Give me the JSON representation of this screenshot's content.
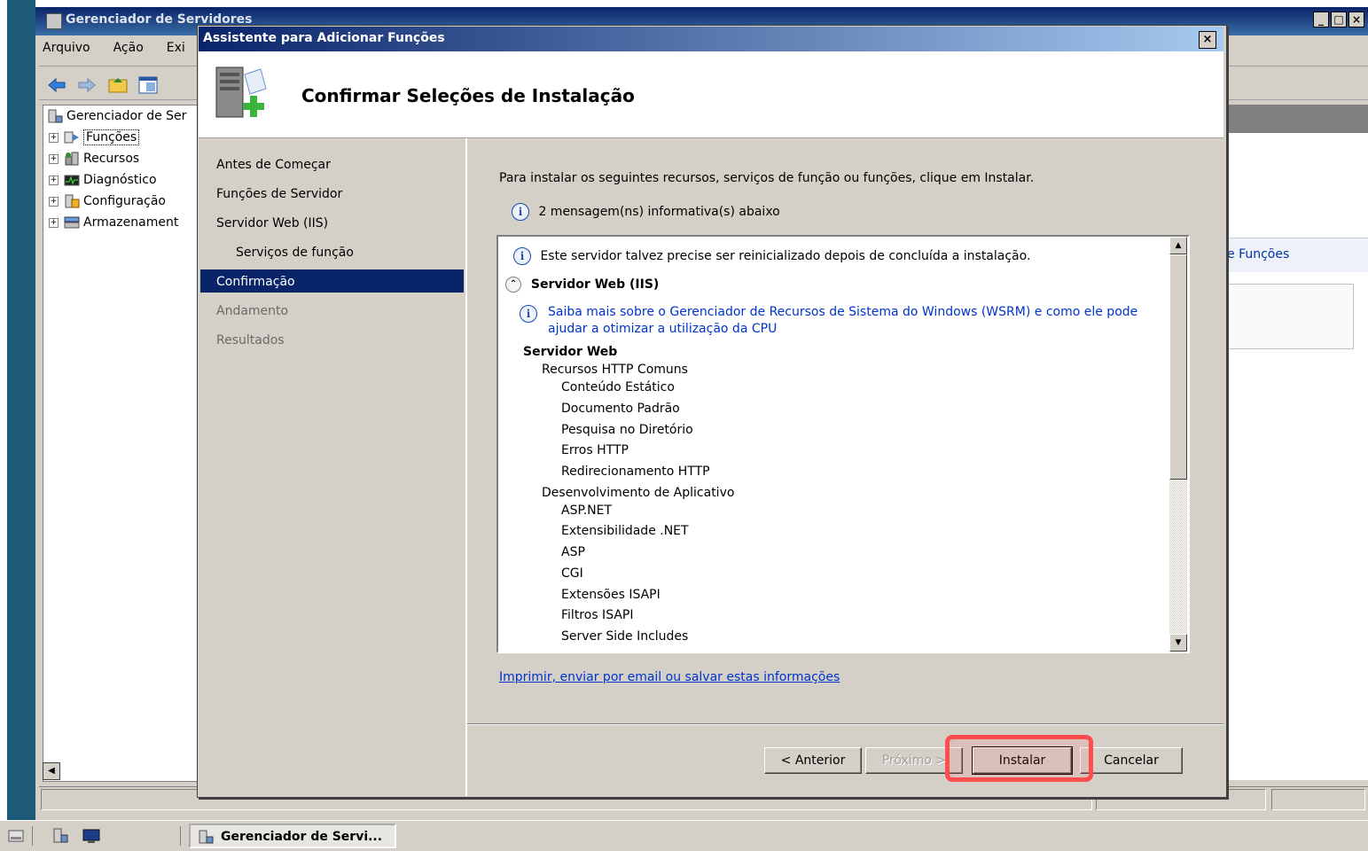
{
  "background_window": {
    "title": "Gerenciador de Servidores",
    "menu": [
      "Arquivo",
      "Ação",
      "Exi"
    ],
    "tree": [
      {
        "label": "Gerenciador de Ser"
      },
      {
        "label": "Funções"
      },
      {
        "label": "Recursos"
      },
      {
        "label": "Diagnóstico"
      },
      {
        "label": "Configuração"
      },
      {
        "label": "Armazenament"
      }
    ],
    "right_link": "e Funções"
  },
  "dialog": {
    "title": "Assistente para Adicionar Funções",
    "heading": "Confirmar Seleções de Instalação",
    "close_label": "×",
    "nav": [
      {
        "label": "Antes de Começar",
        "state": "done"
      },
      {
        "label": "Funções de Servidor",
        "state": "done"
      },
      {
        "label": "Servidor Web (IIS)",
        "state": "done"
      },
      {
        "label": "Serviços de função",
        "state": "done",
        "indent": true
      },
      {
        "label": "Confirmação",
        "state": "selected"
      },
      {
        "label": "Andamento",
        "state": "disabled"
      },
      {
        "label": "Resultados",
        "state": "disabled"
      }
    ],
    "intro": "Para instalar os seguintes recursos, serviços de função ou funções, clique em Instalar.",
    "message_count": "2 mensagem(ns) informativa(s) abaixo",
    "list": {
      "restart_notice": "Este servidor talvez precise ser reinicializado depois de concluída a instalação.",
      "section_title": "Servidor Web (IIS)",
      "wsrm_link_line1": "Saiba mais sobre o Gerenciador de Recursos de Sistema do Windows (WSRM) e como ele pode",
      "wsrm_link_line2": "ajudar a otimizar a utilização da CPU",
      "group_title": "Servidor Web",
      "items": [
        {
          "text": "Recursos HTTP Comuns",
          "level": 1
        },
        {
          "text": "Conteúdo Estático",
          "level": 2
        },
        {
          "text": "Documento Padrão",
          "level": 2
        },
        {
          "text": "Pesquisa no Diretório",
          "level": 2
        },
        {
          "text": "Erros HTTP",
          "level": 2
        },
        {
          "text": "Redirecionamento HTTP",
          "level": 2
        },
        {
          "text": "Desenvolvimento de Aplicativo",
          "level": 1
        },
        {
          "text": "ASP.NET",
          "level": 2
        },
        {
          "text": "Extensibilidade .NET",
          "level": 2
        },
        {
          "text": "ASP",
          "level": 2
        },
        {
          "text": "CGI",
          "level": 2
        },
        {
          "text": "Extensões ISAPI",
          "level": 2
        },
        {
          "text": "Filtros ISAPI",
          "level": 2
        },
        {
          "text": "Server Side Includes",
          "level": 2
        }
      ]
    },
    "print_link": "Imprimir, enviar por email ou salvar estas informações",
    "buttons": {
      "back": "< Anterior",
      "next": "Próximo >",
      "install": "Instalar",
      "cancel": "Cancelar"
    }
  },
  "taskbar": {
    "task_label": "Gerenciador de Servi..."
  },
  "colors": {
    "title_bar": "#0a246a",
    "selection": "#0a246a",
    "highlight": "#ff4d4d",
    "link": "#0033cc"
  }
}
